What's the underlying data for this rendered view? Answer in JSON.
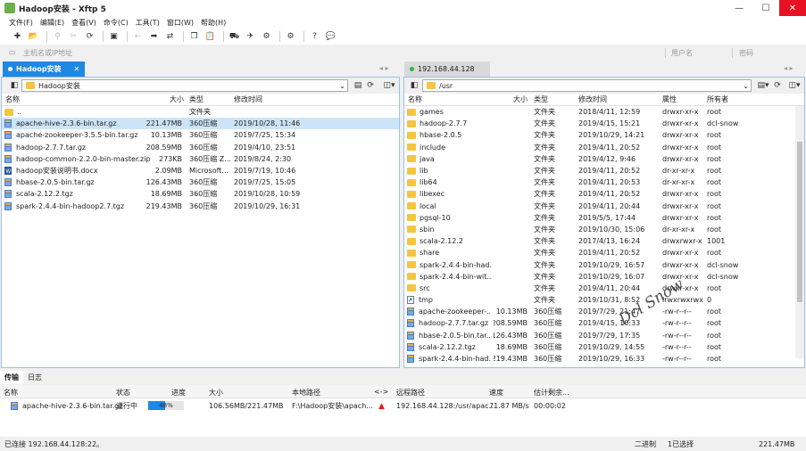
{
  "window": {
    "title": "Hadoop安装 - Xftp 5"
  },
  "menu": [
    "文件(F)",
    "编辑(E)",
    "查看(V)",
    "命令(C)",
    "工具(T)",
    "窗口(W)",
    "帮助(H)"
  ],
  "address": {
    "host_placeholder": "主机名或IP地址",
    "user_placeholder": "用户名",
    "password_placeholder": "密码"
  },
  "left": {
    "tab": "Hadoop安装",
    "path": "Hadoop安装",
    "columns": [
      "名称",
      "大小",
      "类型",
      "修改时间"
    ],
    "rows": [
      {
        "name": "..",
        "size": "",
        "type": "文件夹",
        "mtime": "",
        "kind": "folder"
      },
      {
        "name": "apache-hive-2.3.6-bin.tar.gz",
        "size": "221.47MB",
        "type": "360压缩",
        "mtime": "2019/10/28, 11:46",
        "kind": "archive"
      },
      {
        "name": "apache-zookeeper-3.5.5-bin.tar.gz",
        "size": "10.13MB",
        "type": "360压缩",
        "mtime": "2019/7/25, 15:34",
        "kind": "archive"
      },
      {
        "name": "hadoop-2.7.7.tar.gz",
        "size": "208.59MB",
        "type": "360压缩",
        "mtime": "2019/4/10, 23:51",
        "kind": "archive"
      },
      {
        "name": "hadoop-common-2.2.0-bin-master.zip",
        "size": "273KB",
        "type": "360压缩 Z...",
        "mtime": "2019/8/24, 2:30",
        "kind": "archive"
      },
      {
        "name": "hadoop安装说明书.docx",
        "size": "2.09MB",
        "type": "Microsoft...",
        "mtime": "2019/7/19, 10:46",
        "kind": "doc"
      },
      {
        "name": "hbase-2.0.5-bin.tar.gz",
        "size": "126.43MB",
        "type": "360压缩",
        "mtime": "2019/7/25, 15:05",
        "kind": "archive"
      },
      {
        "name": "scala-2.12.2.tgz",
        "size": "18.69MB",
        "type": "360压缩",
        "mtime": "2019/10/28, 10:59",
        "kind": "archive"
      },
      {
        "name": "spark-2.4.4-bin-hadoop2.7.tgz",
        "size": "219.43MB",
        "type": "360压缩",
        "mtime": "2019/10/29, 16:31",
        "kind": "archive"
      }
    ]
  },
  "right": {
    "tab": "192.168.44.128",
    "path": "/usr",
    "columns": [
      "名称",
      "大小",
      "类型",
      "修改时间",
      "属性",
      "所有者"
    ],
    "rows": [
      {
        "name": "games",
        "size": "",
        "type": "文件夹",
        "mtime": "2018/4/11, 12:59",
        "attr": "drwxr-xr-x",
        "owner": "root",
        "kind": "folder"
      },
      {
        "name": "hadoop-2.7.7",
        "size": "",
        "type": "文件夹",
        "mtime": "2019/4/15, 15:21",
        "attr": "drwxr-xr-x",
        "owner": "dcl-snow",
        "kind": "folder"
      },
      {
        "name": "hbase-2.0.5",
        "size": "",
        "type": "文件夹",
        "mtime": "2019/10/29, 14:21",
        "attr": "drwxr-xr-x",
        "owner": "root",
        "kind": "folder"
      },
      {
        "name": "include",
        "size": "",
        "type": "文件夹",
        "mtime": "2019/4/11, 20:52",
        "attr": "drwxr-xr-x",
        "owner": "root",
        "kind": "folder"
      },
      {
        "name": "java",
        "size": "",
        "type": "文件夹",
        "mtime": "2019/4/12, 9:46",
        "attr": "drwxr-xr-x",
        "owner": "root",
        "kind": "folder"
      },
      {
        "name": "lib",
        "size": "",
        "type": "文件夹",
        "mtime": "2019/4/11, 20:52",
        "attr": "dr-xr-xr-x",
        "owner": "root",
        "kind": "folder"
      },
      {
        "name": "lib64",
        "size": "",
        "type": "文件夹",
        "mtime": "2019/4/11, 20:53",
        "attr": "dr-xr-xr-x",
        "owner": "root",
        "kind": "folder"
      },
      {
        "name": "libexec",
        "size": "",
        "type": "文件夹",
        "mtime": "2019/4/11, 20:52",
        "attr": "drwxr-xr-x",
        "owner": "root",
        "kind": "folder"
      },
      {
        "name": "local",
        "size": "",
        "type": "文件夹",
        "mtime": "2019/4/11, 20:44",
        "attr": "drwxr-xr-x",
        "owner": "root",
        "kind": "folder"
      },
      {
        "name": "pgsql-10",
        "size": "",
        "type": "文件夹",
        "mtime": "2019/5/5, 17:44",
        "attr": "drwxr-xr-x",
        "owner": "root",
        "kind": "folder"
      },
      {
        "name": "sbin",
        "size": "",
        "type": "文件夹",
        "mtime": "2019/10/30, 15:06",
        "attr": "dr-xr-xr-x",
        "owner": "root",
        "kind": "folder"
      },
      {
        "name": "scala-2.12.2",
        "size": "",
        "type": "文件夹",
        "mtime": "2017/4/13, 16:24",
        "attr": "drwxrwxr-x",
        "owner": "1001",
        "kind": "folder"
      },
      {
        "name": "share",
        "size": "",
        "type": "文件夹",
        "mtime": "2019/4/11, 20:52",
        "attr": "drwxr-xr-x",
        "owner": "root",
        "kind": "folder"
      },
      {
        "name": "spark-2.4.4-bin-had...",
        "size": "",
        "type": "文件夹",
        "mtime": "2019/10/29, 16:57",
        "attr": "drwxr-xr-x",
        "owner": "dcl-snow",
        "kind": "folder"
      },
      {
        "name": "spark-2.4.4-bin-wit...",
        "size": "",
        "type": "文件夹",
        "mtime": "2019/10/29, 16:07",
        "attr": "drwxr-xr-x",
        "owner": "dcl-snow",
        "kind": "folder"
      },
      {
        "name": "src",
        "size": "",
        "type": "文件夹",
        "mtime": "2019/4/11, 20:44",
        "attr": "drwxr-xr-x",
        "owner": "root",
        "kind": "folder"
      },
      {
        "name": "tmp",
        "size": "",
        "type": "文件夹",
        "mtime": "2019/10/31, 8:52",
        "attr": "lrwxrwxrwx",
        "owner": "0",
        "kind": "link"
      },
      {
        "name": "apache-zookeeper-...",
        "size": "10.13MB",
        "type": "360压缩",
        "mtime": "2019/7/29, 21:47",
        "attr": "-rw-r--r--",
        "owner": "root",
        "kind": "archive"
      },
      {
        "name": "hadoop-2.7.7.tar.gz",
        "size": "208.59MB",
        "type": "360压缩",
        "mtime": "2019/4/15, 10:33",
        "attr": "-rw-r--r--",
        "owner": "root",
        "kind": "archive"
      },
      {
        "name": "hbase-2.0.5-bin.tar....",
        "size": "126.43MB",
        "type": "360压缩",
        "mtime": "2019/7/29, 17:35",
        "attr": "-rw-r--r--",
        "owner": "root",
        "kind": "archive"
      },
      {
        "name": "scala-2.12.2.tgz",
        "size": "18.69MB",
        "type": "360压缩",
        "mtime": "2019/10/29, 14:55",
        "attr": "-rw-r--r--",
        "owner": "root",
        "kind": "archive"
      },
      {
        "name": "spark-2.4.4-bin-had...",
        "size": "219.43MB",
        "type": "360压缩",
        "mtime": "2019/10/29, 16:33",
        "attr": "-rw-r--r--",
        "owner": "root",
        "kind": "archive"
      }
    ]
  },
  "transfer": {
    "tabs": [
      "传输",
      "日志"
    ],
    "columns": [
      "名称",
      "状态",
      "进度",
      "大小",
      "本地路径",
      "<->",
      "远程路径",
      "速度",
      "估计剩余..."
    ],
    "row": {
      "name": "apache-hive-2.3.6-bin.tar.gz",
      "status": "进行中",
      "progress": 0.48,
      "progress_text": "48%",
      "size": "106.56MB/221.47MB",
      "local": "F:\\Hadoop安装\\apach...",
      "remote": "192.168.44.128:/usr/apac...",
      "speed": "71.87 MB/s",
      "eta": "00:00:02"
    }
  },
  "status": {
    "left": "已连接 192.168.44.128:22。",
    "mode": "二进制",
    "selected": "1已选择",
    "size": "221.47MB"
  },
  "watermark": "Dcl Snow",
  "colors": {
    "accent": "#1e88e5",
    "folder": "#f5c542",
    "connected": "#2db84d",
    "close": "#e81123"
  }
}
